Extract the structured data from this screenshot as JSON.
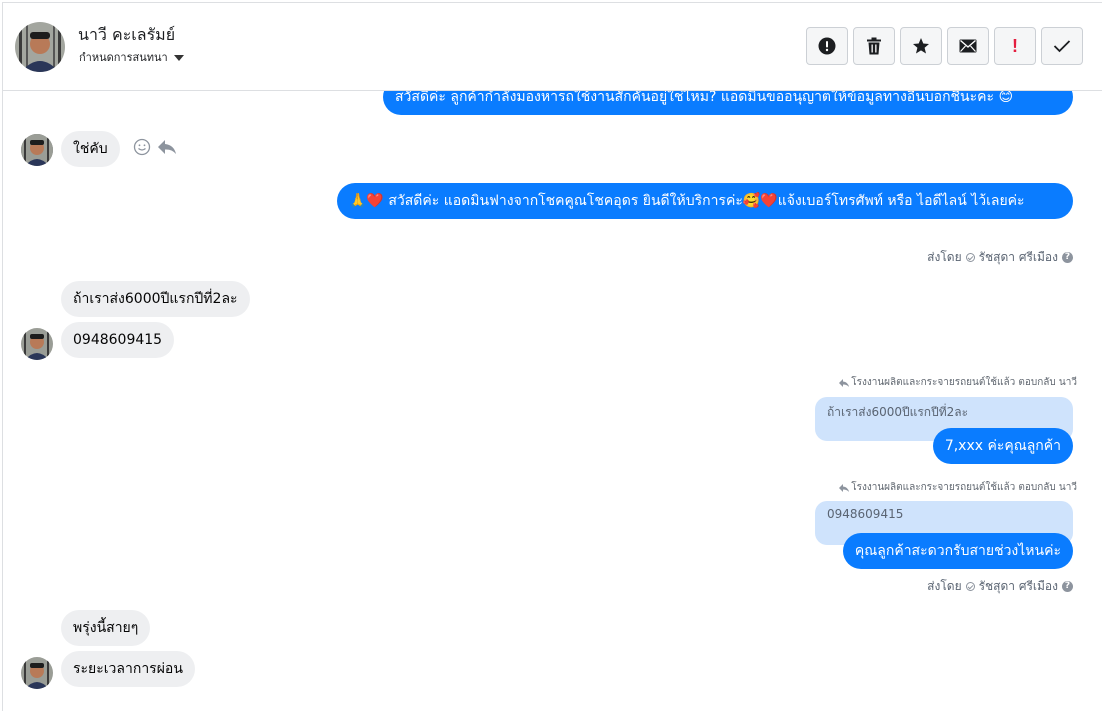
{
  "header": {
    "name": "นาวี คะเลรัมย์",
    "assign_label": "กำหนดการสนทนา",
    "tools": [
      {
        "icon": "alert-circle-icon",
        "name": "mark-spam-button"
      },
      {
        "icon": "trash-icon",
        "name": "delete-button"
      },
      {
        "icon": "star-icon",
        "name": "star-button"
      },
      {
        "icon": "envelope-icon",
        "name": "mark-unread-button"
      },
      {
        "icon": "exclamation-icon",
        "name": "follow-up-button",
        "glyph": "!"
      },
      {
        "icon": "checkmark-icon",
        "name": "mark-done-button"
      }
    ]
  },
  "messages": [
    {
      "id": "m0",
      "direction": "out",
      "text": "สวัสดีค่ะ ลูกค้ากำลังมองหารถใช้งานสักคันอยู่ใช่ไหม? แอดมินขออนุญาตให้ข้อมูลทางอื่นบอกชื่นะคะ 😊"
    },
    {
      "id": "m1",
      "direction": "in",
      "text": "ใช่คับ"
    },
    {
      "id": "m2",
      "direction": "out",
      "text": "🙏❤️ สวัสดีค่ะ แอดมินฟางจากโชคคูณโชคอุดร ยินดีให้บริการค่ะ🥰❤️แจ้งเบอร์โทรศัพท์ หรือ ไอดีไลน์  ไว้เลยค่ะ"
    },
    {
      "id": "m3",
      "direction": "in",
      "text": "ถ้าเราส่ง6000ปีแรกปีที่2ละ"
    },
    {
      "id": "m4",
      "direction": "in",
      "text": "0948609415"
    },
    {
      "id": "m5",
      "direction": "out",
      "quote": "ถ้าเราส่ง6000ปีแรกปีที่2ละ",
      "text": "7,xxx ค่ะคุณลูกค้า"
    },
    {
      "id": "m6",
      "direction": "out",
      "quote": "0948609415",
      "text": "คุณลูกค้าสะดวกรับสายช่วงไหนค่ะ"
    },
    {
      "id": "m7",
      "direction": "in",
      "text": "พรุ่งนี้สายๆ"
    },
    {
      "id": "m8",
      "direction": "in",
      "text": "ระยะเวลาการผ่อน"
    }
  ],
  "sent_by": {
    "prefix": "ส่งโดย",
    "name": "รัชสุดา ศรีเมือง",
    "help": "?"
  },
  "reply_note": "โรงงานผลิตและกระจายรถยนต์ใช้แล้ว ตอบกลับ นาวี"
}
